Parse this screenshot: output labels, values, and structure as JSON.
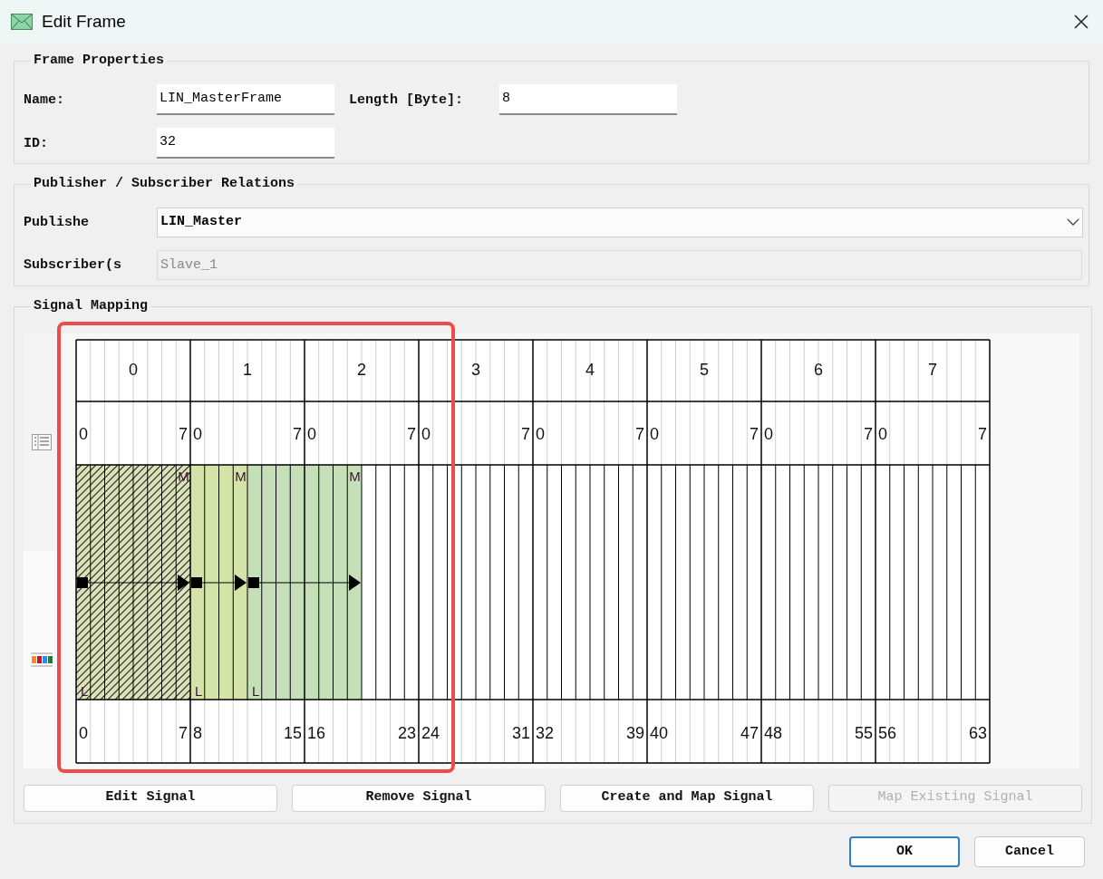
{
  "window": {
    "title": "Edit Frame"
  },
  "frame_properties": {
    "title": "Frame Properties",
    "name_label": "Name:",
    "name_value": "LIN_MasterFrame",
    "length_label": "Length [Byte]:",
    "length_value": "8",
    "id_label": "ID:",
    "id_value": "32"
  },
  "relations": {
    "title": "Publisher / Subscriber Relations",
    "publisher_label": "Publishe",
    "publisher_value": "LIN_Master",
    "subscriber_label": "Subscriber(s",
    "subscriber_value": "Slave_1",
    "subscriber_disabled": true
  },
  "signal_mapping": {
    "title": "Signal Mapping",
    "bytes": [
      {
        "label": "0",
        "bit_low": "0",
        "bit_high": "7",
        "start_bit": "0",
        "end_bit": "7",
        "cells": [
          {
            "kind": "signal",
            "color": "#dde3b8",
            "selected": true,
            "lsb_marker": "L"
          },
          {
            "kind": "signal",
            "color": "#dde3b8",
            "selected": true
          },
          {
            "kind": "signal",
            "color": "#dde3b8",
            "selected": true
          },
          {
            "kind": "signal",
            "color": "#dde3b8",
            "selected": true
          },
          {
            "kind": "signal",
            "color": "#dde3b8",
            "selected": true
          },
          {
            "kind": "signal",
            "color": "#dde3b8",
            "selected": true
          },
          {
            "kind": "signal",
            "color": "#dde3b8",
            "selected": true
          },
          {
            "kind": "signal",
            "color": "#dde3b8",
            "selected": true,
            "msb_marker": "M"
          }
        ]
      },
      {
        "label": "1",
        "bit_low": "0",
        "bit_high": "7",
        "start_bit": "8",
        "end_bit": "15",
        "cells": [
          {
            "kind": "signal",
            "color": "#d4e3a8",
            "selected": false,
            "lsb_marker": "L"
          },
          {
            "kind": "signal",
            "color": "#d4e3a8",
            "selected": false
          },
          {
            "kind": "signal",
            "color": "#d4e3a8",
            "selected": false
          },
          {
            "kind": "signal",
            "color": "#d4e3a8",
            "selected": false,
            "msb_marker": "M"
          },
          {
            "kind": "signal",
            "color": "#c5dfb9",
            "selected": false,
            "lsb_marker": "L"
          },
          {
            "kind": "signal",
            "color": "#c5dfb9",
            "selected": false
          },
          {
            "kind": "signal",
            "color": "#c5dfb9",
            "selected": false
          },
          {
            "kind": "signal",
            "color": "#c5dfb9",
            "selected": false
          }
        ]
      },
      {
        "label": "2",
        "bit_low": "0",
        "bit_high": "7",
        "start_bit": "16",
        "end_bit": "23",
        "cells": [
          {
            "kind": "signal",
            "color": "#c5dfb9",
            "selected": false
          },
          {
            "kind": "signal",
            "color": "#c5dfb9",
            "selected": false
          },
          {
            "kind": "signal",
            "color": "#c5dfb9",
            "selected": false
          },
          {
            "kind": "signal",
            "color": "#c5dfb9",
            "selected": false,
            "msb_marker": "M"
          },
          {
            "kind": "empty"
          },
          {
            "kind": "empty"
          },
          {
            "kind": "empty"
          },
          {
            "kind": "empty"
          }
        ]
      },
      {
        "label": "3",
        "bit_low": "0",
        "bit_high": "7",
        "start_bit": "24",
        "end_bit": "31",
        "cells": [
          {
            "kind": "empty"
          },
          {
            "kind": "empty"
          },
          {
            "kind": "empty"
          },
          {
            "kind": "empty"
          },
          {
            "kind": "empty"
          },
          {
            "kind": "empty"
          },
          {
            "kind": "empty"
          },
          {
            "kind": "empty"
          }
        ]
      },
      {
        "label": "4",
        "bit_low": "0",
        "bit_high": "7",
        "start_bit": "32",
        "end_bit": "39",
        "cells": [
          {
            "kind": "empty"
          },
          {
            "kind": "empty"
          },
          {
            "kind": "empty"
          },
          {
            "kind": "empty"
          },
          {
            "kind": "empty"
          },
          {
            "kind": "empty"
          },
          {
            "kind": "empty"
          },
          {
            "kind": "empty"
          }
        ]
      },
      {
        "label": "5",
        "bit_low": "0",
        "bit_high": "7",
        "start_bit": "40",
        "end_bit": "47",
        "cells": [
          {
            "kind": "empty"
          },
          {
            "kind": "empty"
          },
          {
            "kind": "empty"
          },
          {
            "kind": "empty"
          },
          {
            "kind": "empty"
          },
          {
            "kind": "empty"
          },
          {
            "kind": "empty"
          },
          {
            "kind": "empty"
          }
        ]
      },
      {
        "label": "6",
        "bit_low": "0",
        "bit_high": "7",
        "start_bit": "48",
        "end_bit": "55",
        "cells": [
          {
            "kind": "empty"
          },
          {
            "kind": "empty"
          },
          {
            "kind": "empty"
          },
          {
            "kind": "empty"
          },
          {
            "kind": "empty"
          },
          {
            "kind": "empty"
          },
          {
            "kind": "empty"
          },
          {
            "kind": "empty"
          }
        ]
      },
      {
        "label": "7",
        "bit_low": "0",
        "bit_high": "7",
        "start_bit": "56",
        "end_bit": "63",
        "cells": [
          {
            "kind": "empty"
          },
          {
            "kind": "empty"
          },
          {
            "kind": "empty"
          },
          {
            "kind": "empty"
          },
          {
            "kind": "empty"
          },
          {
            "kind": "empty"
          },
          {
            "kind": "empty"
          },
          {
            "kind": "empty"
          }
        ]
      }
    ],
    "buttons": [
      {
        "label": "Edit Signal",
        "disabled": false
      },
      {
        "label": "Remove Signal",
        "disabled": false
      },
      {
        "label": "Create and Map Signal",
        "disabled": false
      },
      {
        "label": "Map Existing Signal",
        "disabled": true
      }
    ]
  },
  "dialog_buttons": [
    {
      "label": "OK",
      "default": true
    },
    {
      "label": "Cancel",
      "default": false
    }
  ]
}
